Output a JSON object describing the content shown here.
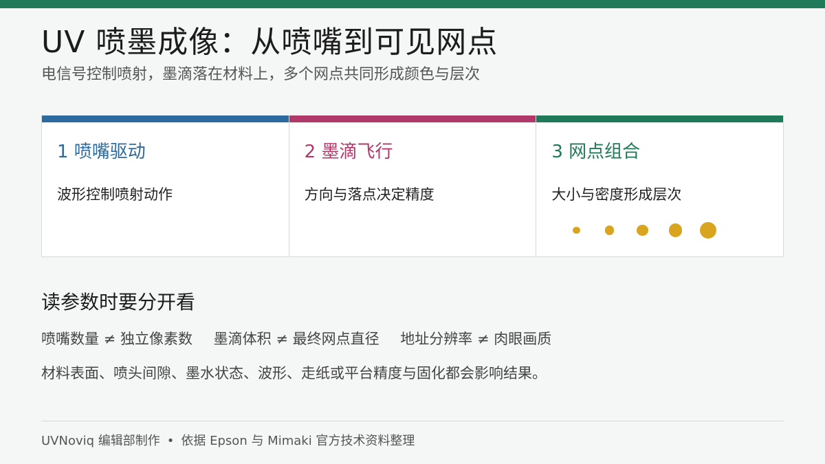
{
  "colors": {
    "top_bar": "#1f7a59",
    "card1": "#2d6a9f",
    "card2": "#b0396a",
    "card3": "#1f7a59",
    "dot": "#d9a520"
  },
  "header": {
    "title": "UV 喷墨成像：从喷嘴到可见网点",
    "subtitle": "电信号控制喷射，墨滴落在材料上，多个网点共同形成颜色与层次"
  },
  "cards": [
    {
      "title": "1  喷嘴驱动",
      "desc": "波形控制喷射动作"
    },
    {
      "title": "2  墨滴飞行",
      "desc": "方向与落点决定精度"
    },
    {
      "title": "3  网点组合",
      "desc": "大小与密度形成层次"
    }
  ],
  "dot_scale": [
    0.45,
    0.55,
    0.7,
    0.8,
    1.0
  ],
  "section": {
    "title": "读参数时要分开看",
    "comparisons": [
      "喷嘴数量 ≠ 独立像素数",
      "墨滴体积 ≠ 最终网点直径",
      "地址分辨率 ≠ 肉眼画质"
    ],
    "note": "材料表面、喷头间隙、墨水状态、波形、走纸或平台精度与固化都会影响结果。"
  },
  "footer": {
    "credit": "UVNoviq 编辑部制作",
    "separator": "•",
    "source": "依据 Epson 与 Mimaki 官方技术资料整理"
  }
}
